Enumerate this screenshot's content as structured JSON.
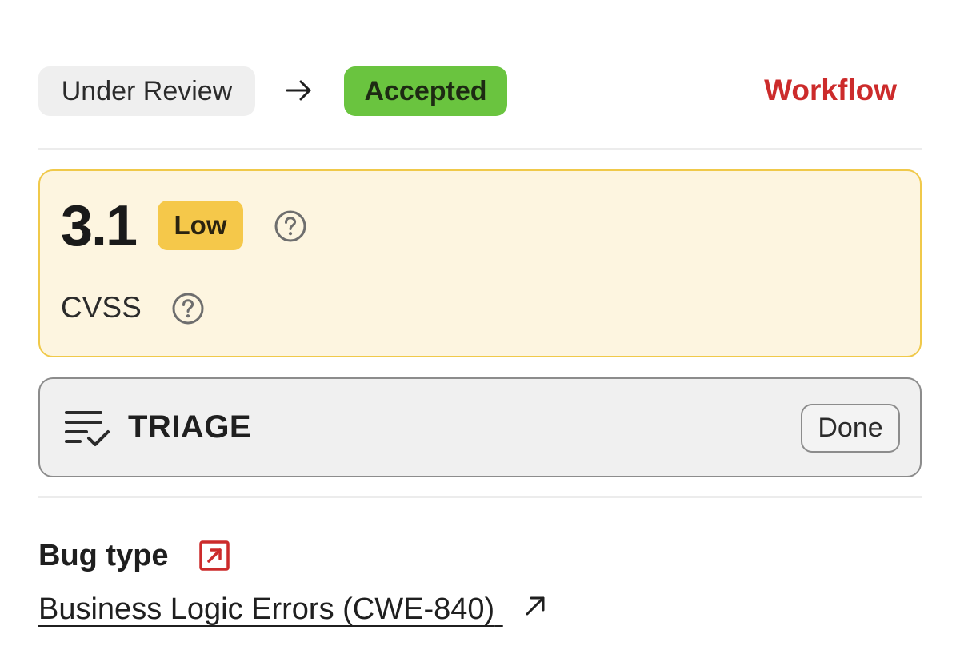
{
  "workflow": {
    "from_status": "Under Review",
    "to_status": "Accepted",
    "link_label": "Workflow"
  },
  "severity": {
    "score": "3.1",
    "rating": "Low",
    "metric_label": "CVSS"
  },
  "triage": {
    "title": "TRIAGE",
    "status": "Done"
  },
  "bug_type": {
    "heading": "Bug type",
    "value": "Business Logic Errors (CWE-840)"
  },
  "icons": {
    "status_arrow": "arrow-right-icon",
    "help": "question-circle-icon",
    "triage": "list-check-icon",
    "external": "external-link-icon"
  },
  "colors": {
    "accepted_bg": "#6ac43f",
    "workflow_link": "#cc2b2b",
    "severity_low_bg": "#f5c84a",
    "severity_card_bg": "#fdf5e0",
    "severity_card_border": "#f0c94a"
  }
}
